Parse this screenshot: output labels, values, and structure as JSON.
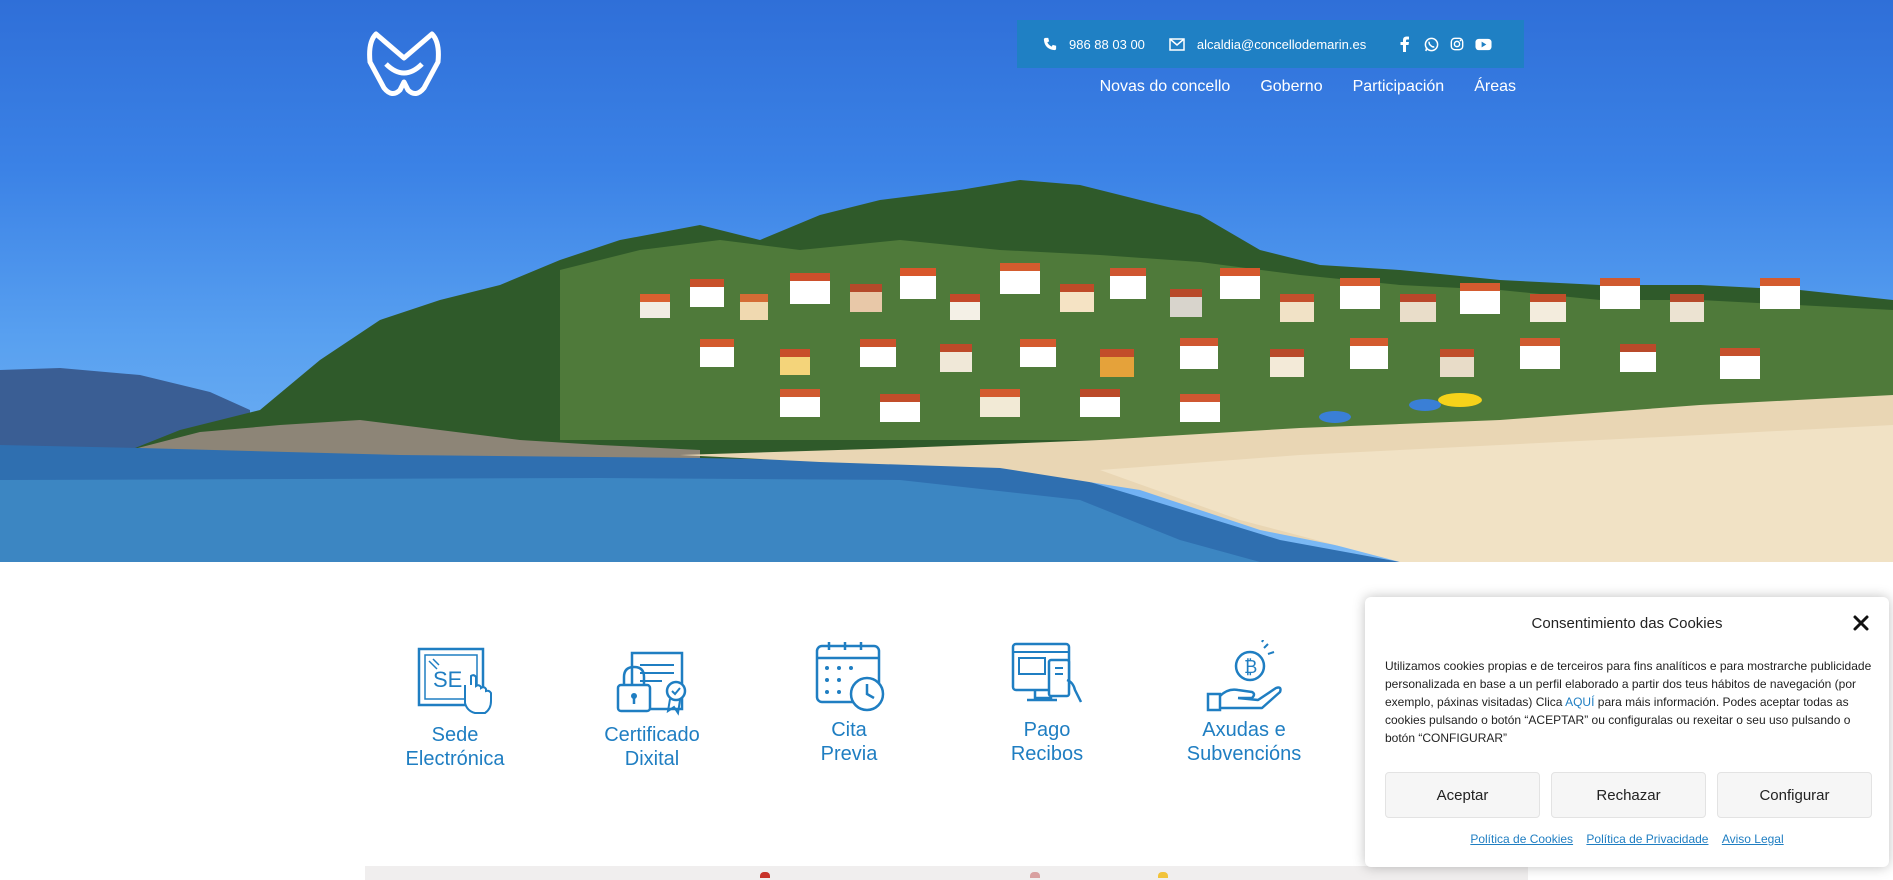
{
  "header": {
    "logo_icon": "concello-marin-m-logo",
    "contact": {
      "phone": "986 88 03 00",
      "email": "alcaldia@concellodemarin.es",
      "socials": [
        "facebook-icon",
        "whatsapp-icon",
        "instagram-icon",
        "youtube-icon"
      ]
    },
    "nav": [
      {
        "label": "Novas do concello"
      },
      {
        "label": "Goberno"
      },
      {
        "label": "Participación"
      },
      {
        "label": "Áreas"
      }
    ]
  },
  "services": [
    {
      "line1": "Sede",
      "line2": "Electrónica",
      "icon": "sede-electronica-icon"
    },
    {
      "line1": "Certificado",
      "line2": "Dixital",
      "icon": "certificado-icon"
    },
    {
      "line1": "Cita",
      "line2": "Previa",
      "icon": "calendar-clock-icon"
    },
    {
      "line1": "Pago",
      "line2": "Recibos",
      "icon": "payment-terminal-icon"
    },
    {
      "line1": "Axudas e",
      "line2": "Subvencións",
      "icon": "hand-coin-icon"
    }
  ],
  "cookie": {
    "title": "Consentimiento das Cookies",
    "text_before": "Utilizamos cookies propias e de terceiros para fins analíticos e para mostrarche publicidade personalizada en base a un perfil elaborado a partir dos teus hábitos de navegación (por exemplo, páxinas visitadas) Clica ",
    "text_link": "AQUÍ",
    "text_after": " para máis información. Podes aceptar todas as cookies pulsando o botón “ACEPTAR” ou configuralas ou rexeitar o seu uso pulsando o botón “CONFIGURAR”",
    "buttons": {
      "accept": "Aceptar",
      "reject": "Rechazar",
      "configure": "Configurar"
    },
    "links": {
      "cookies": "Política de Cookies",
      "privacy": "Política de Privacidade",
      "legal": "Aviso Legal"
    }
  },
  "colors": {
    "brand_blue": "#1f7ec2",
    "contact_bar": "#1f80c4"
  }
}
